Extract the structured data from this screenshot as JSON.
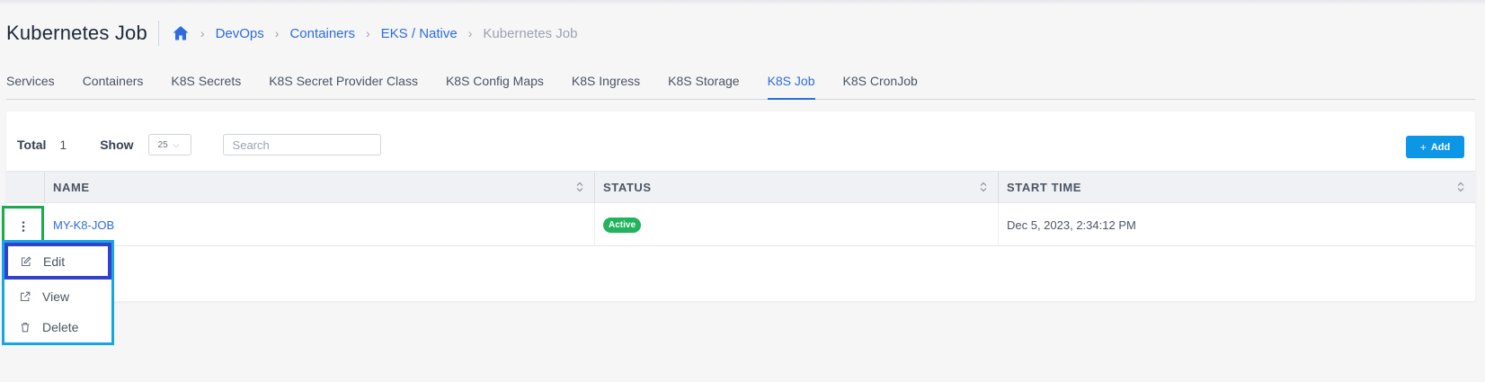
{
  "header": {
    "title": "Kubernetes Job",
    "breadcrumbs": [
      "DevOps",
      "Containers",
      "EKS / Native"
    ],
    "current": "Kubernetes Job"
  },
  "tabs": [
    {
      "label": "Services"
    },
    {
      "label": "Containers"
    },
    {
      "label": "K8S Secrets"
    },
    {
      "label": "K8S Secret Provider Class"
    },
    {
      "label": "K8S Config Maps"
    },
    {
      "label": "K8S Ingress"
    },
    {
      "label": "K8S Storage"
    },
    {
      "label": "K8S Job",
      "active": true
    },
    {
      "label": "K8S CronJob"
    }
  ],
  "toolbar": {
    "total_label": "Total",
    "total_value": "1",
    "show_label": "Show",
    "show_value": "25",
    "search_placeholder": "Search",
    "add_label": "Add"
  },
  "table": {
    "columns": [
      "NAME",
      "STATUS",
      "START TIME"
    ],
    "rows": [
      {
        "name": "MY-K8-JOB",
        "status": "Active",
        "start_time": "Dec 5, 2023, 2:34:12 PM"
      }
    ]
  },
  "row_menu": {
    "items": [
      "Edit",
      "View",
      "Delete"
    ]
  },
  "colors": {
    "accent": "#2c6ce0",
    "add_button": "#0b96e6",
    "status_active": "#22b35e",
    "highlight_green": "#1cab4d",
    "highlight_indigo": "#3342cc",
    "highlight_cyan": "#15a6e8"
  }
}
